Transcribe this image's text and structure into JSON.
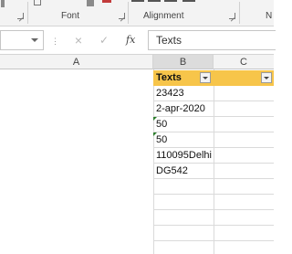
{
  "ribbon": {
    "group_font": "Font",
    "group_alignment": "Alignment",
    "launcher_icon": "dialog-launcher-icon"
  },
  "formula_bar": {
    "name_box_value": "",
    "cancel_icon": "×",
    "enter_icon": "✓",
    "fx_label": "fx",
    "formula_value": "Texts"
  },
  "columns": [
    "A",
    "B",
    "C"
  ],
  "table": {
    "header": "Texts",
    "rows": [
      "23423",
      "2-apr-2020",
      "50",
      "50",
      "110095Delhi",
      "DG542"
    ]
  },
  "colors": {
    "header_fill": "#f7c54a",
    "error_indicator": "#2b7d2b"
  }
}
